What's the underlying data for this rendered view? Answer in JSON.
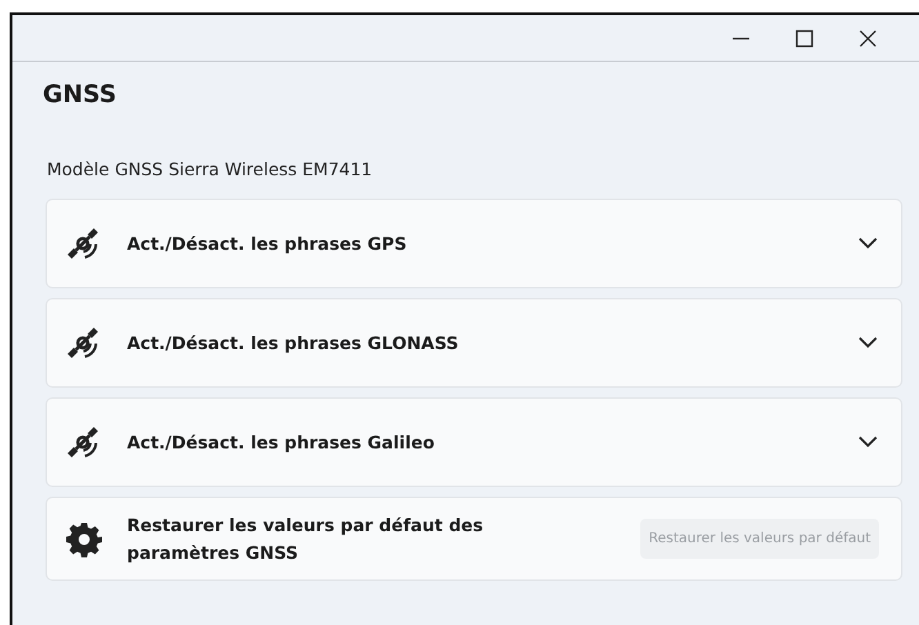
{
  "page": {
    "title": "GNSS",
    "model": "Modèle GNSS Sierra Wireless EM7411"
  },
  "sections": [
    {
      "kind": "expander",
      "label": "Act./Désact. les phrases GPS",
      "expanded": false
    },
    {
      "kind": "expander",
      "label": "Act./Désact. les phrases GLONASS",
      "expanded": false
    },
    {
      "kind": "expander",
      "label": "Act./Désact. les phrases Galileo",
      "expanded": false
    },
    {
      "kind": "action",
      "label": "Restaurer les valeurs par défaut des paramètres GNSS",
      "button": "Restaurer les valeurs par défaut",
      "disabled": true
    }
  ]
}
